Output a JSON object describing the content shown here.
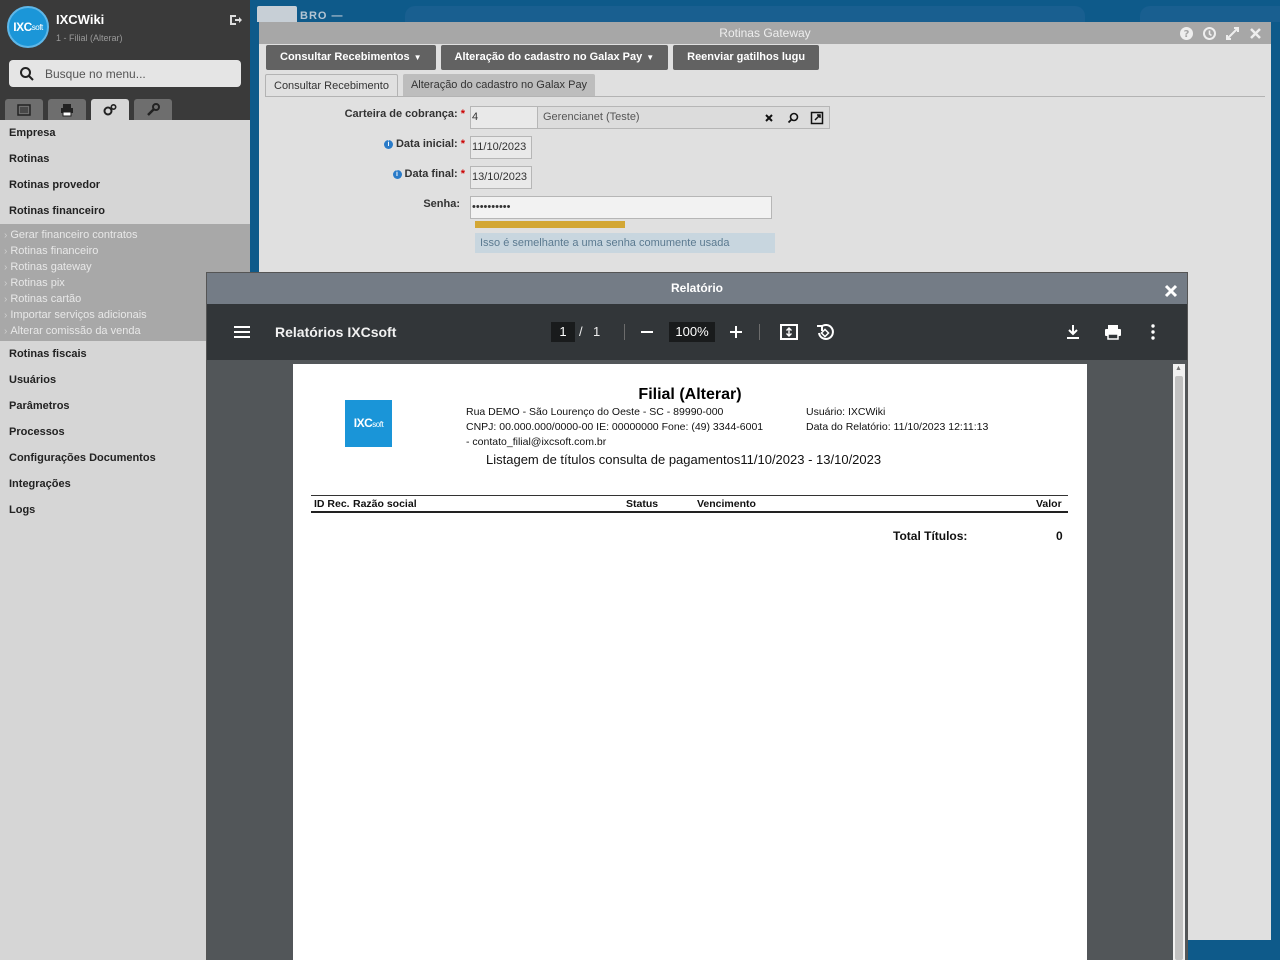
{
  "sidebar": {
    "app_name": "IXCWiki",
    "app_sub": "1 - Filial (Alterar)",
    "logo_text": "IXC",
    "logo_small": "soft",
    "search_placeholder": "Busque no menu...",
    "menu_top": [
      {
        "label": "Empresa"
      },
      {
        "label": "Rotinas"
      },
      {
        "label": "Rotinas provedor"
      },
      {
        "label": "Rotinas financeiro"
      }
    ],
    "submenu": [
      {
        "label": "Gerar financeiro contratos"
      },
      {
        "label": "Rotinas financeiro"
      },
      {
        "label": "Rotinas gateway"
      },
      {
        "label": "Rotinas pix"
      },
      {
        "label": "Rotinas cartão"
      },
      {
        "label": "Importar serviços adicionais"
      },
      {
        "label": "Alterar comissão da venda"
      }
    ],
    "menu_bottom": [
      {
        "label": "Rotinas fiscais"
      },
      {
        "label": "Usuários"
      },
      {
        "label": "Parâmetros"
      },
      {
        "label": "Processos"
      },
      {
        "label": "Configurações Documentos"
      },
      {
        "label": "Integrações"
      },
      {
        "label": "Logs"
      }
    ]
  },
  "back_window": {
    "bg_tab_text": "BRO —",
    "title": "Rotinas Gateway",
    "toolbar": {
      "btn1": "Consultar Recebimentos",
      "btn2": "Alteração do cadastro no Galax Pay",
      "btn3": "Reenviar gatilhos lugu"
    },
    "tabs": {
      "tab1": "Consultar Recebimento",
      "tab2": "Alteração do cadastro no Galax Pay"
    },
    "form": {
      "carteira_label": "Carteira de cobrança:",
      "carteira_id": "4",
      "carteira_name": "Gerencianet (Teste)",
      "data_inicial_label": "Data inicial:",
      "data_inicial": "11/10/2023",
      "data_final_label": "Data final:",
      "data_final": "13/10/2023",
      "senha_label": "Senha:",
      "senha_value": "••••••••••",
      "password_strength": 0.5,
      "password_msg": "Isso é semelhante a uma senha comumente usada"
    }
  },
  "dialog": {
    "title": "Relatório",
    "pdf": {
      "title": "Relatórios IXCsoft",
      "page": "1",
      "slash": "/",
      "total_pages": "1",
      "zoom": "100%"
    },
    "report": {
      "logo_text": "IXC",
      "logo_small": "soft",
      "title": "Filial (Alterar)",
      "address": "Rua DEMO - São Lourenço do Oeste - SC - 89990-000",
      "ids": "CNPJ: 00.000.000/0000-00  IE: 00000000  Fone: (49) 3344-6001",
      "email": " - contato_filial@ixcsoft.com.br",
      "user": "Usuário: IXCWiki",
      "date": "Data do Relatório: 11/10/2023 12:11:13",
      "listing": "Listagem de títulos consulta de pagamentos11/10/2023 - 13/10/2023",
      "columns": {
        "id": "ID Rec.",
        "razao": "Razão social",
        "status": "Status",
        "vencimento": "Vencimento",
        "valor": "Valor"
      },
      "total_label": "Total Títulos:",
      "total_value": "0"
    }
  },
  "colors": {
    "accent": "#1a95d8",
    "sidebar_dark": "#3a3a3a",
    "pdf_toolbar": "#323639",
    "strength_bar": "#d3a735"
  }
}
